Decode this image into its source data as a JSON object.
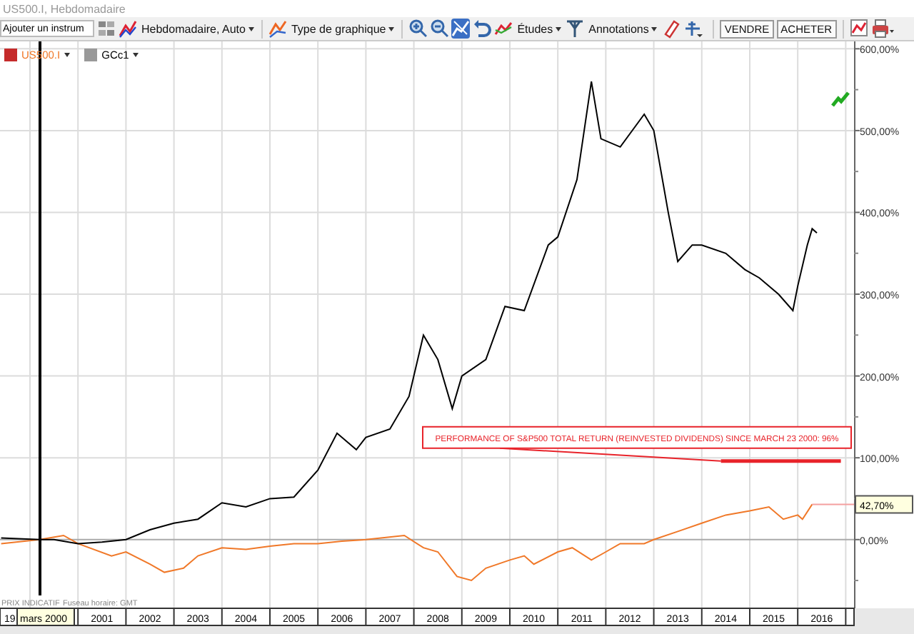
{
  "window": {
    "title": "US500.I, Hebdomadaire"
  },
  "toolbar": [
    {
      "kind": "field",
      "value": "Ajouter un instrum"
    },
    {
      "kind": "icon",
      "selected": false
    },
    {
      "kind": "icon",
      "selected": false
    },
    {
      "kind": "dropdown",
      "label": "Hebdomadaire, Auto"
    },
    {
      "kind": "separator"
    },
    {
      "kind": "icon",
      "selected": false
    },
    {
      "kind": "dropdown",
      "label": "Type de graphique"
    },
    {
      "kind": "separator"
    },
    {
      "kind": "icon",
      "selected": false
    },
    {
      "kind": "icon",
      "selected": false
    },
    {
      "kind": "icon",
      "selected": true
    },
    {
      "kind": "icon",
      "selected": false
    },
    {
      "kind": "icon",
      "selected": false
    },
    {
      "kind": "dropdown",
      "label": "Études"
    },
    {
      "kind": "icon",
      "selected": false
    },
    {
      "kind": "dropdown",
      "label": "Annotations"
    },
    {
      "kind": "icon",
      "selected": false
    },
    {
      "kind": "icon",
      "selected": false
    },
    {
      "kind": "separator"
    },
    {
      "kind": "button",
      "label": "VENDRE"
    },
    {
      "kind": "button",
      "label": "ACHETER"
    },
    {
      "kind": "separator"
    },
    {
      "kind": "icon",
      "selected": false
    },
    {
      "kind": "icon",
      "selected": false
    }
  ],
  "chart": {
    "footnote": "PRIX INDICATIF",
    "timezone": "Fuseau horaire: GMT",
    "cut_axis_label": "19",
    "crosshair_label": "mars 2000",
    "last_value_label": "42,70%",
    "chart_data": {
      "type": "line",
      "grid": true,
      "xlim": [
        1998.875,
        2016.673
      ],
      "ylim": [
        -84,
        609
      ],
      "xticks": [
        {
          "value": 2001,
          "label": "2001"
        },
        {
          "value": 2002,
          "label": "2002"
        },
        {
          "value": 2003,
          "label": "2003"
        },
        {
          "value": 2004,
          "label": "2004"
        },
        {
          "value": 2005,
          "label": "2005"
        },
        {
          "value": 2006,
          "label": "2006"
        },
        {
          "value": 2007,
          "label": "2007"
        },
        {
          "value": 2008,
          "label": "2008"
        },
        {
          "value": 2009,
          "label": "2009"
        },
        {
          "value": 2010,
          "label": "2010"
        },
        {
          "value": 2011,
          "label": "2011"
        },
        {
          "value": 2012,
          "label": "2012"
        },
        {
          "value": 2013,
          "label": "2013"
        },
        {
          "value": 2014,
          "label": "2014"
        },
        {
          "value": 2015,
          "label": "2015"
        },
        {
          "value": 2016,
          "label": "2016"
        }
      ],
      "yticks": [
        {
          "value": 0,
          "label": "0,00%"
        },
        {
          "value": 100,
          "label": "100,00%"
        },
        {
          "value": 200,
          "label": "200,00%"
        },
        {
          "value": 300,
          "label": "300,00%"
        },
        {
          "value": 400,
          "label": "400,00%"
        },
        {
          "value": 500,
          "label": "500,00%"
        },
        {
          "value": 600,
          "label": "600,00%"
        }
      ],
      "series": [
        {
          "name": "US500.I",
          "color": "#f07828",
          "x": [
            1998.9,
            1999.7,
            2000.2,
            2000.5,
            2001.2,
            2001.5,
            2002.0,
            2002.3,
            2002.7,
            2003.0,
            2003.5,
            2004.0,
            2004.5,
            2005.0,
            2005.5,
            2006.0,
            2006.5,
            2007.3,
            2007.7,
            2008.0,
            2008.4,
            2008.7,
            2009.0,
            2009.5,
            2009.8,
            2010.0,
            2010.5,
            2010.8,
            2011.2,
            2011.5,
            2011.8,
            2012.3,
            2012.5,
            2013.0,
            2013.5,
            2014.0,
            2014.5,
            2014.9,
            2015.2,
            2015.5,
            2015.6,
            2015.8
          ],
          "values": [
            -5,
            0,
            5,
            -5,
            -20,
            -15,
            -30,
            -40,
            -35,
            -20,
            -10,
            -12,
            -8,
            -5,
            -5,
            -2,
            0,
            5,
            -10,
            -15,
            -45,
            -50,
            -35,
            -25,
            -20,
            -30,
            -15,
            -10,
            -25,
            -15,
            -5,
            -5,
            0,
            10,
            20,
            30,
            35,
            40,
            25,
            30,
            25,
            43
          ]
        },
        {
          "name": "GCc1",
          "color": "#000000",
          "x": [
            1998.9,
            1999.7,
            2000.0,
            2000.5,
            2001.0,
            2001.5,
            2002.0,
            2002.5,
            2003.0,
            2003.5,
            2004.0,
            2004.5,
            2005.0,
            2005.5,
            2005.9,
            2006.3,
            2006.5,
            2007.0,
            2007.4,
            2007.7,
            2008.0,
            2008.3,
            2008.5,
            2009.0,
            2009.4,
            2009.8,
            2010.3,
            2010.5,
            2010.9,
            2011.2,
            2011.4,
            2011.8,
            2012.3,
            2012.5,
            2012.8,
            2013.0,
            2013.3,
            2013.5,
            2014.0,
            2014.4,
            2014.7,
            2015.1,
            2015.4,
            2015.5,
            2015.7,
            2015.8,
            2015.9
          ],
          "values": [
            2,
            0,
            0,
            -5,
            -3,
            0,
            12,
            20,
            25,
            45,
            40,
            50,
            52,
            85,
            130,
            110,
            125,
            135,
            175,
            250,
            220,
            160,
            200,
            220,
            285,
            280,
            360,
            370,
            440,
            560,
            490,
            480,
            520,
            500,
            400,
            340,
            360,
            360,
            350,
            330,
            320,
            300,
            280,
            310,
            360,
            380,
            375
          ]
        },
        {
          "name": "PERFORMANCE OF S&P500 TOTAL RETURN (REINVESTED DIVIDENDS) SINCE MARCH 23 2000: 96%",
          "color": "#e8232a",
          "x": [
            2013.9,
            2016.4
          ],
          "values": [
            96,
            96
          ]
        }
      ]
    }
  }
}
